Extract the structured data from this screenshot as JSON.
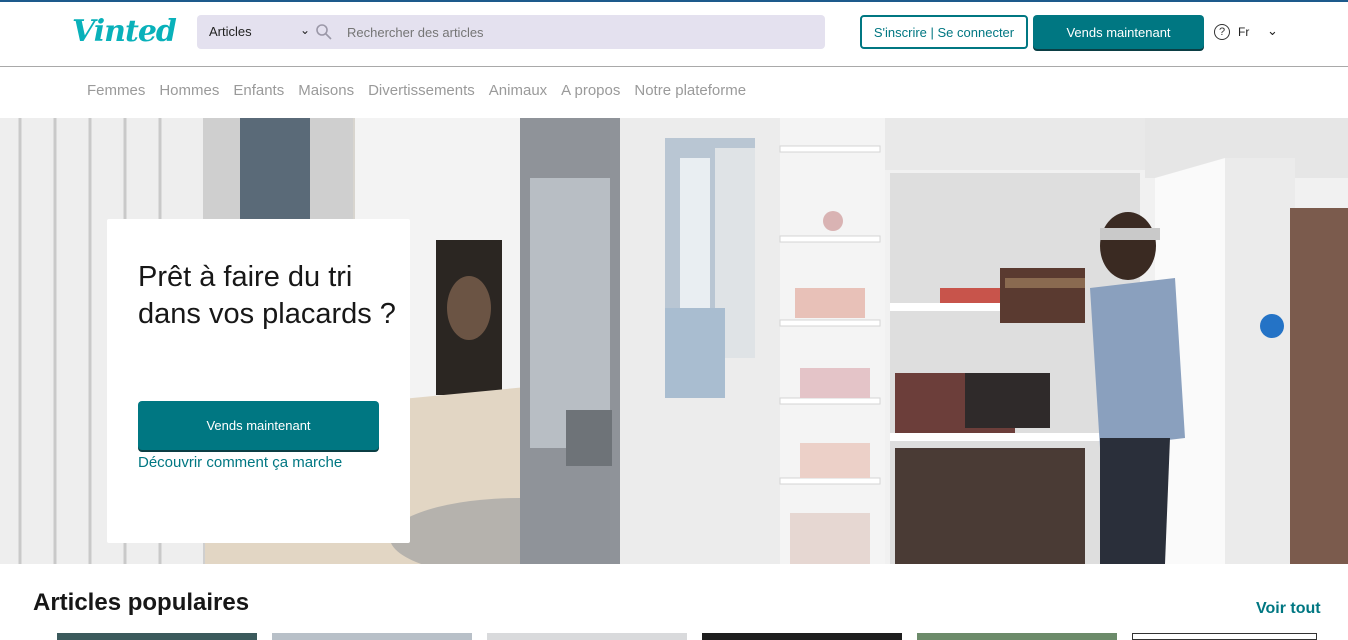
{
  "brand": {
    "logo_text": "Vinted",
    "accent_color": "#007782",
    "logo_color": "#09b1ba"
  },
  "search": {
    "category": "Articles",
    "placeholder": "Rechercher des articles",
    "icon": "search-icon"
  },
  "header": {
    "auth_label": "S'inscrire | Se connecter",
    "sell_label": "Vends maintenant",
    "help_icon": "help-icon",
    "language": "Fr"
  },
  "nav": {
    "items": [
      "Femmes",
      "Hommes",
      "Enfants",
      "Maisons",
      "Divertissements",
      "Animaux",
      "A propos",
      "Notre plateforme"
    ]
  },
  "hero": {
    "title": "Prêt à faire du tri dans vos placards ?",
    "cta_label": "Vends maintenant",
    "link_label": "Découvrir comment ça marche"
  },
  "popular": {
    "title": "Articles populaires",
    "see_all_label": "Voir tout"
  }
}
